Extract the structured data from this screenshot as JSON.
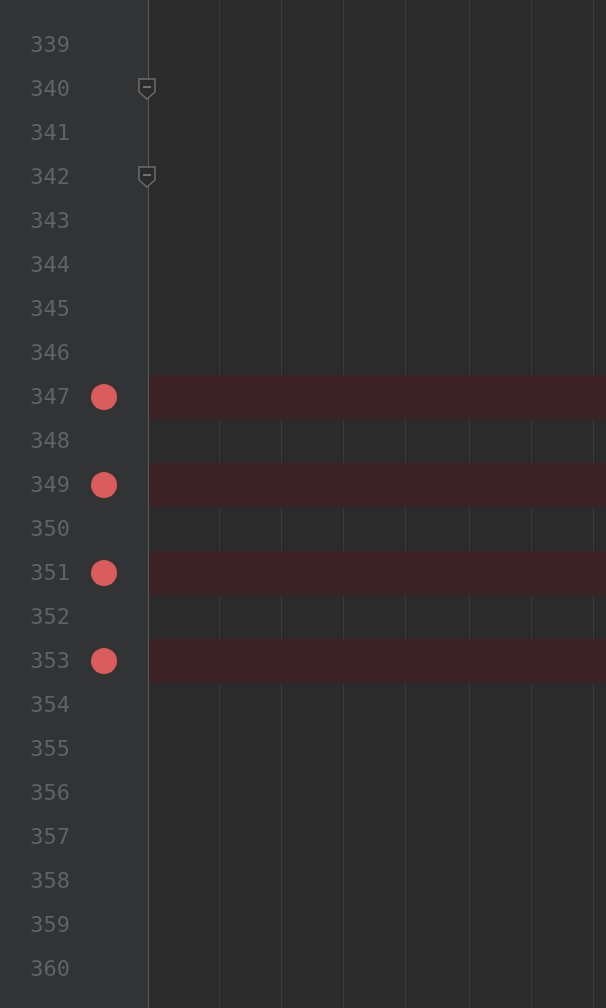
{
  "lines": [
    {
      "number": "339",
      "breakpoint": false,
      "fold": false
    },
    {
      "number": "340",
      "breakpoint": false,
      "fold": true
    },
    {
      "number": "341",
      "breakpoint": false,
      "fold": false
    },
    {
      "number": "342",
      "breakpoint": false,
      "fold": true
    },
    {
      "number": "343",
      "breakpoint": false,
      "fold": false
    },
    {
      "number": "344",
      "breakpoint": false,
      "fold": false
    },
    {
      "number": "345",
      "breakpoint": false,
      "fold": false
    },
    {
      "number": "346",
      "breakpoint": false,
      "fold": false
    },
    {
      "number": "347",
      "breakpoint": true,
      "fold": false
    },
    {
      "number": "348",
      "breakpoint": false,
      "fold": false
    },
    {
      "number": "349",
      "breakpoint": true,
      "fold": false
    },
    {
      "number": "350",
      "breakpoint": false,
      "fold": false
    },
    {
      "number": "351",
      "breakpoint": true,
      "fold": false
    },
    {
      "number": "352",
      "breakpoint": false,
      "fold": false
    },
    {
      "number": "353",
      "breakpoint": true,
      "fold": false
    },
    {
      "number": "354",
      "breakpoint": false,
      "fold": false
    },
    {
      "number": "355",
      "breakpoint": false,
      "fold": false
    },
    {
      "number": "356",
      "breakpoint": false,
      "fold": false
    },
    {
      "number": "357",
      "breakpoint": false,
      "fold": false
    },
    {
      "number": "358",
      "breakpoint": false,
      "fold": false
    },
    {
      "number": "359",
      "breakpoint": false,
      "fold": false
    },
    {
      "number": "360",
      "breakpoint": false,
      "fold": false
    }
  ]
}
